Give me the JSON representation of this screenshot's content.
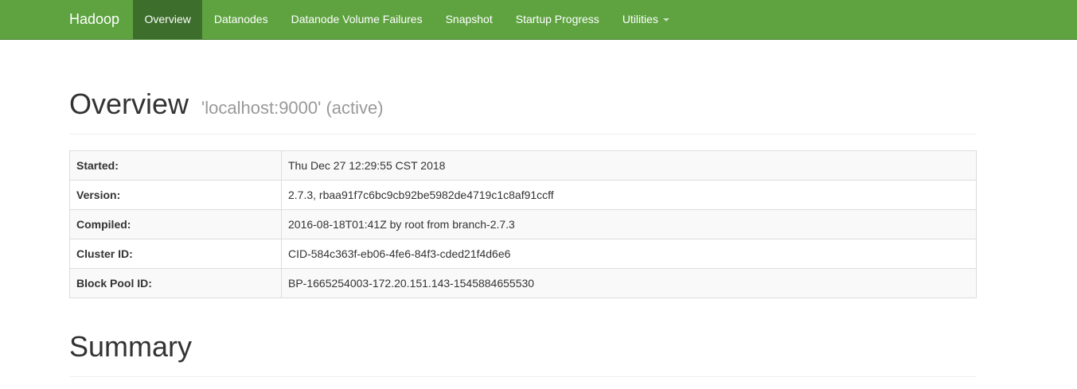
{
  "navbar": {
    "brand": "Hadoop",
    "items": [
      {
        "label": "Overview",
        "active": true
      },
      {
        "label": "Datanodes",
        "active": false
      },
      {
        "label": "Datanode Volume Failures",
        "active": false
      },
      {
        "label": "Snapshot",
        "active": false
      },
      {
        "label": "Startup Progress",
        "active": false
      },
      {
        "label": "Utilities",
        "active": false,
        "dropdown": true
      }
    ],
    "color": "#5fa341",
    "active_color": "#3d6e2c"
  },
  "overview": {
    "title": "Overview",
    "subtitle": "'localhost:9000' (active)",
    "rows": [
      {
        "key": "Started:",
        "value": "Thu Dec 27 12:29:55 CST 2018"
      },
      {
        "key": "Version:",
        "value": "2.7.3, rbaa91f7c6bc9cb92be5982de4719c1c8af91ccff"
      },
      {
        "key": "Compiled:",
        "value": "2016-08-18T01:41Z by root from branch-2.7.3"
      },
      {
        "key": "Cluster ID:",
        "value": "CID-584c363f-eb06-4fe6-84f3-cded21f4d6e6"
      },
      {
        "key": "Block Pool ID:",
        "value": "BP-1665254003-172.20.151.143-1545884655530"
      }
    ]
  },
  "summary": {
    "title": "Summary"
  }
}
